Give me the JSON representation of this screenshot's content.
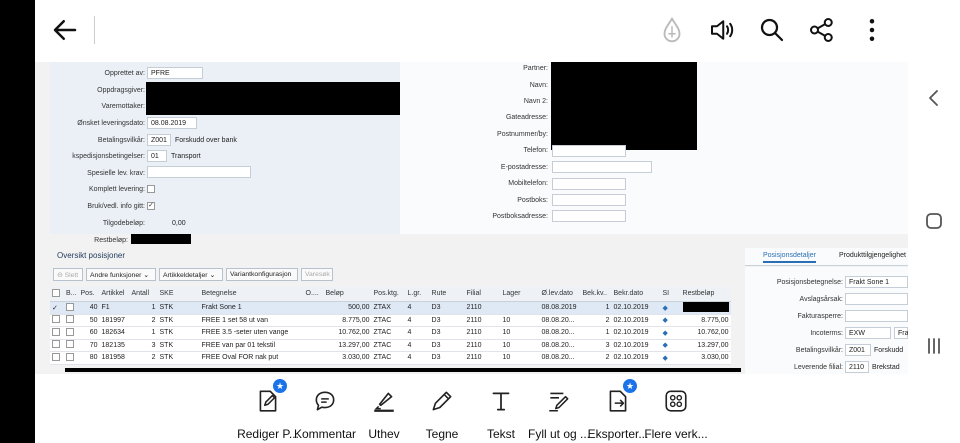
{
  "appbar": {
    "back_icon": "arrow-left-icon",
    "icons": [
      "drop-icon",
      "speaker-icon",
      "search-icon",
      "share-icon",
      "more-vert-icon"
    ]
  },
  "header_left": {
    "created_by_label": "Opprettet av:",
    "created_by_value": "PFRE",
    "ordering_party_label": "Oppdragsgiver:",
    "consignee_label": "Varemottaker:",
    "requested_date_label": "Ønsket leveringsdato:",
    "requested_date_value": "08.08.2019",
    "payment_terms_label": "Betalingsvilkår:",
    "payment_terms_code": "Z001",
    "payment_terms_text": "Forskudd over bank",
    "shipping_terms_label": "kspedisjonsbetingelser:",
    "shipping_terms_code": "01",
    "shipping_terms_text": "Transport",
    "special_req_label": "Spesielle lev. krav:",
    "complete_delivery_label": "Komplett levering:",
    "usage_info_label": "Bruk/vedl. info gitt:",
    "usage_info_checked": "✓",
    "credit_label": "Tilgodebeløp:",
    "credit_value": "0,00",
    "balance_label": "Restbeløp:"
  },
  "header_right": {
    "partner_label": "Partner:",
    "name_label": "Navn:",
    "name2_label": "Navn 2:",
    "street_label": "Gateadresse:",
    "postcode_label": "Postnummer/by:",
    "phone_label": "Telefon:",
    "email_label": "E-postadresse:",
    "mobile_label": "Mobiltelefon:",
    "pobox_label": "Postboks:",
    "pobox_address_label": "Postboksadresse:"
  },
  "items_section": {
    "title": "Oversikt posisjoner",
    "toolbar": {
      "delete": "Slett",
      "other_functions": "Andre funksjoner",
      "item_details": "Artikkeldetaljer",
      "variant_config": "Variantkonfigurasjon",
      "search": "Varesøk"
    },
    "columns": [
      "B...",
      "Pos.",
      "Artikkel",
      "Antall",
      "SKE",
      "Betegnelse",
      "O....",
      "Beløp",
      "Pos.ktg.",
      "L.gr.",
      "Rute",
      "Filial",
      "Lager",
      "Ø.lev.dato",
      "Bek.kv..",
      "Bekr.dato",
      "SI",
      "Restbeløp"
    ],
    "rows": [
      {
        "check": "✓",
        "pos": "40",
        "article": "F1",
        "qty": "1",
        "unit": "STK",
        "desc": "Frakt Sone 1",
        "o": "",
        "amount": "500,00",
        "cat": "ZTAX",
        "lgr": "4",
        "route": "D3",
        "branch": "2110",
        "stock": "",
        "req_date": "08.08.2019",
        "conf_qty": "1",
        "conf_date": "02.10.2019",
        "si": "◆",
        "rest": ""
      },
      {
        "check": "",
        "pos": "50",
        "article": "181997",
        "qty": "2",
        "unit": "STK",
        "desc": "FREE 1 set 58 ut van",
        "o": "",
        "amount": "8.775,00",
        "cat": "ZTAC",
        "lgr": "4",
        "route": "D3",
        "branch": "2110",
        "stock": "10",
        "req_date": "08.08.20...",
        "conf_qty": "2",
        "conf_date": "02.10.2019",
        "si": "◆",
        "rest": "8.775,00"
      },
      {
        "check": "",
        "pos": "60",
        "article": "182634",
        "qty": "1",
        "unit": "STK",
        "desc": "FREE 3.5 -seter uten vange",
        "o": "",
        "amount": "10.762,00",
        "cat": "ZTAC",
        "lgr": "4",
        "route": "D3",
        "branch": "2110",
        "stock": "10",
        "req_date": "08.08.20...",
        "conf_qty": "1",
        "conf_date": "02.10.2019",
        "si": "◆",
        "rest": "10.762,00"
      },
      {
        "check": "",
        "pos": "70",
        "article": "182135",
        "qty": "3",
        "unit": "STK",
        "desc": "FREE van par 01 tekstil",
        "o": "",
        "amount": "13.297,00",
        "cat": "ZTAC",
        "lgr": "4",
        "route": "D3",
        "branch": "2110",
        "stock": "10",
        "req_date": "08.08.20...",
        "conf_qty": "3",
        "conf_date": "02.10.2019",
        "si": "◆",
        "rest": "13.297,00"
      },
      {
        "check": "",
        "pos": "80",
        "article": "181958",
        "qty": "2",
        "unit": "STK",
        "desc": "FREE Oval FOR nak put",
        "o": "",
        "amount": "3.030,00",
        "cat": "ZTAC",
        "lgr": "4",
        "route": "D3",
        "branch": "2110",
        "stock": "10",
        "req_date": "08.08.20...",
        "conf_qty": "2",
        "conf_date": "02.10.2019",
        "si": "◆",
        "rest": "3.030,00"
      }
    ]
  },
  "details_panel": {
    "tab_position": "Posisjonsdetaljer",
    "tab_availability": "Produkttilgjengelighet",
    "desc_label": "Posisjonsbetegnelse:",
    "desc_value": "Frakt Sone 1",
    "reject_label": "Avslagsårsak:",
    "billing_block_label": "Fakturasperre:",
    "incoterms_label": "Incoterms:",
    "incoterms_code": "EXW",
    "incoterms_text": "Fra",
    "payment_terms_label": "Betalingsvilkår:",
    "payment_terms_code": "Z001",
    "payment_terms_text": "Forskudd",
    "supplying_branch_label": "Leverende filial:",
    "supplying_branch_code": "2110",
    "supplying_branch_text": "Brekstad"
  },
  "bottom_toolbar": {
    "items": [
      {
        "label": "Rediger P...",
        "icon": "edit-document-icon",
        "starred": true
      },
      {
        "label": "Kommentar",
        "icon": "comment-icon",
        "starred": false
      },
      {
        "label": "Uthev",
        "icon": "highlighter-icon",
        "starred": false
      },
      {
        "label": "Tegne",
        "icon": "pen-icon",
        "starred": false
      },
      {
        "label": "Tekst",
        "icon": "text-icon",
        "starred": false
      },
      {
        "label": "Fyll ut og ...",
        "icon": "fill-sign-icon",
        "starred": false
      },
      {
        "label": "Eksporter...",
        "icon": "export-icon",
        "starred": true
      },
      {
        "label": "Flere verk...",
        "icon": "more-tools-icon",
        "starred": false
      }
    ]
  },
  "android_nav": {
    "icons": [
      "nav-back-icon",
      "nav-home-icon",
      "nav-recents-icon"
    ]
  }
}
